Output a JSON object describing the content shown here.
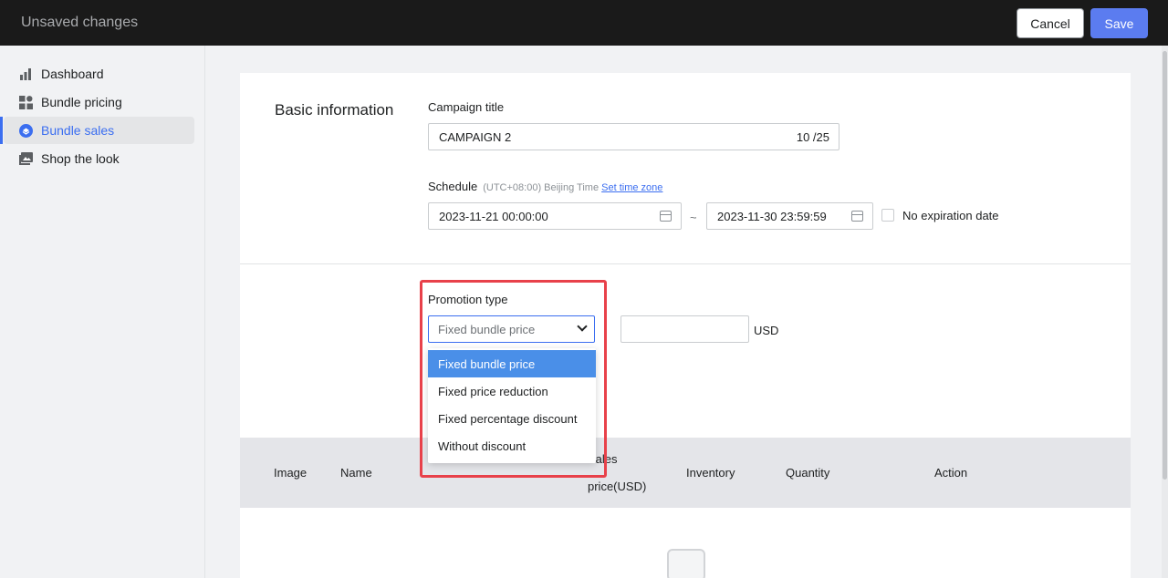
{
  "topbar": {
    "title": "Unsaved changes",
    "cancel": "Cancel",
    "save": "Save"
  },
  "sidebar": {
    "items": [
      {
        "label": "Dashboard",
        "icon": "bar-chart-icon"
      },
      {
        "label": "Bundle pricing",
        "icon": "grid-icon"
      },
      {
        "label": "Bundle sales",
        "icon": "tag-circle-icon",
        "active": true
      },
      {
        "label": "Shop the look",
        "icon": "image-icon"
      }
    ]
  },
  "basic": {
    "section_title": "Basic information",
    "campaign_title_label": "Campaign title",
    "campaign_title_value": "CAMPAIGN 2",
    "campaign_title_count": "10 /25",
    "schedule_label": "Schedule",
    "timezone_text": "(UTC+08:00) Beijing Time",
    "set_timezone_link": "Set time zone",
    "start_date": "2023-11-21 00:00:00",
    "separator": "~",
    "end_date": "2023-11-30 23:59:59",
    "no_expiration_label": "No expiration date"
  },
  "promotion": {
    "label": "Promotion type",
    "selected": "Fixed bundle price",
    "amount_value": "",
    "currency": "USD",
    "options": [
      "Fixed bundle price",
      "Fixed price reduction",
      "Fixed percentage discount",
      "Without discount"
    ]
  },
  "table": {
    "headers": {
      "image": "Image",
      "name": "Name",
      "sales_price_1": "Sales",
      "sales_price_2": "price(USD)",
      "inventory": "Inventory",
      "quantity": "Quantity",
      "action": "Action"
    }
  },
  "colors": {
    "primary": "#5b7cf0",
    "highlight": "#e8414a",
    "selected_option": "#4a8fe8"
  }
}
